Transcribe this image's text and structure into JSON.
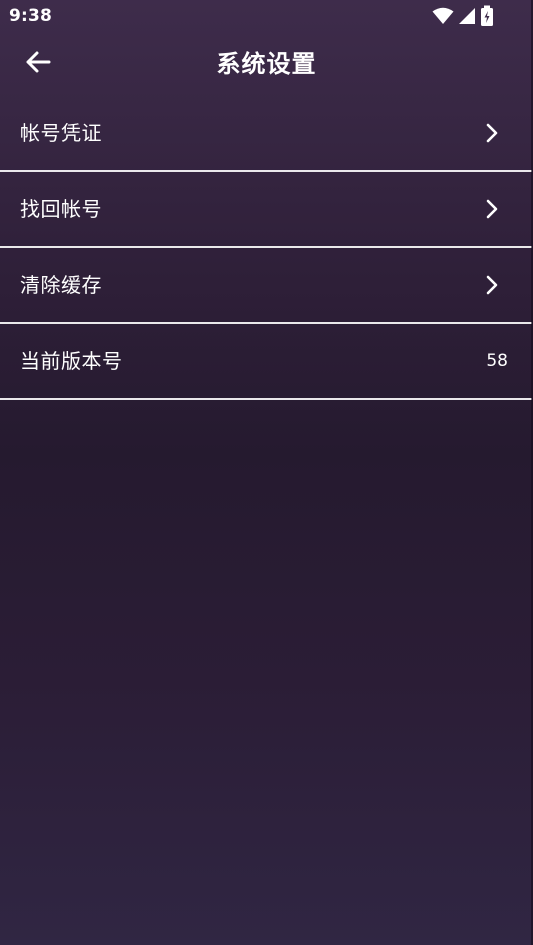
{
  "status_bar": {
    "time": "9:38",
    "icons": [
      "wifi-icon",
      "cell-signal-icon",
      "battery-charging-icon"
    ]
  },
  "header": {
    "title": "系统设置",
    "back_icon": "arrow-left-icon"
  },
  "settings": {
    "items": [
      {
        "label": "帐号凭证",
        "icon": "chevron-right-icon"
      },
      {
        "label": "找回帐号",
        "icon": "chevron-right-icon"
      },
      {
        "label": "清除缓存",
        "icon": "chevron-right-icon"
      },
      {
        "label": "当前版本号",
        "value": "58"
      }
    ]
  },
  "colors": {
    "background_top": "#3e2c4b",
    "background_mid": "#251a2f",
    "background_bottom": "#302643",
    "text": "#ffffff",
    "divider": "#ffffff"
  }
}
